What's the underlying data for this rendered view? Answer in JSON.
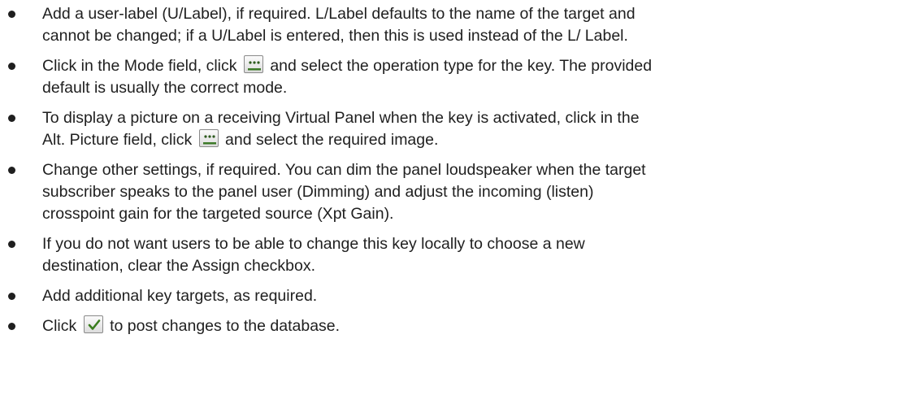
{
  "items": [
    {
      "lines": [
        "Add a user-label (U/Label), if required. L/Label defaults to the name of the target and",
        "cannot be changed; if a U/Label is entered, then this is used instead of the L/ Label."
      ]
    },
    {
      "segments": [
        "Click in the Mode field, click ",
        " and select the operation type for the key. The provided"
      ],
      "line2": "default is usually the correct mode.",
      "icon": "ellipsis-button-icon"
    },
    {
      "line1": "To display a picture on a receiving Virtual Panel when the key is activated, click in the",
      "segments": [
        "Alt. Picture field, click ",
        " and select the required image."
      ],
      "icon": "ellipsis-button-icon"
    },
    {
      "lines": [
        "Change other settings, if required. You can dim the panel loudspeaker when the target",
        "subscriber speaks to the panel user (Dimming) and adjust the incoming (listen)",
        "crosspoint gain for the targeted source (Xpt Gain)."
      ]
    },
    {
      "lines": [
        "If you do not want users to be able to change this key locally to choose a new",
        "destination, clear the Assign checkbox."
      ]
    },
    {
      "lines": [
        "Add additional key targets, as required."
      ]
    },
    {
      "segments": [
        "Click ",
        " to post changes to the database."
      ],
      "icon": "checkmark-button-icon"
    }
  ],
  "colors": {
    "text": "#1f1f1f",
    "ellipsis_dots": "#2d5a1e",
    "ellipsis_bar": "#3c7a28",
    "check": "#3a7d1e"
  }
}
